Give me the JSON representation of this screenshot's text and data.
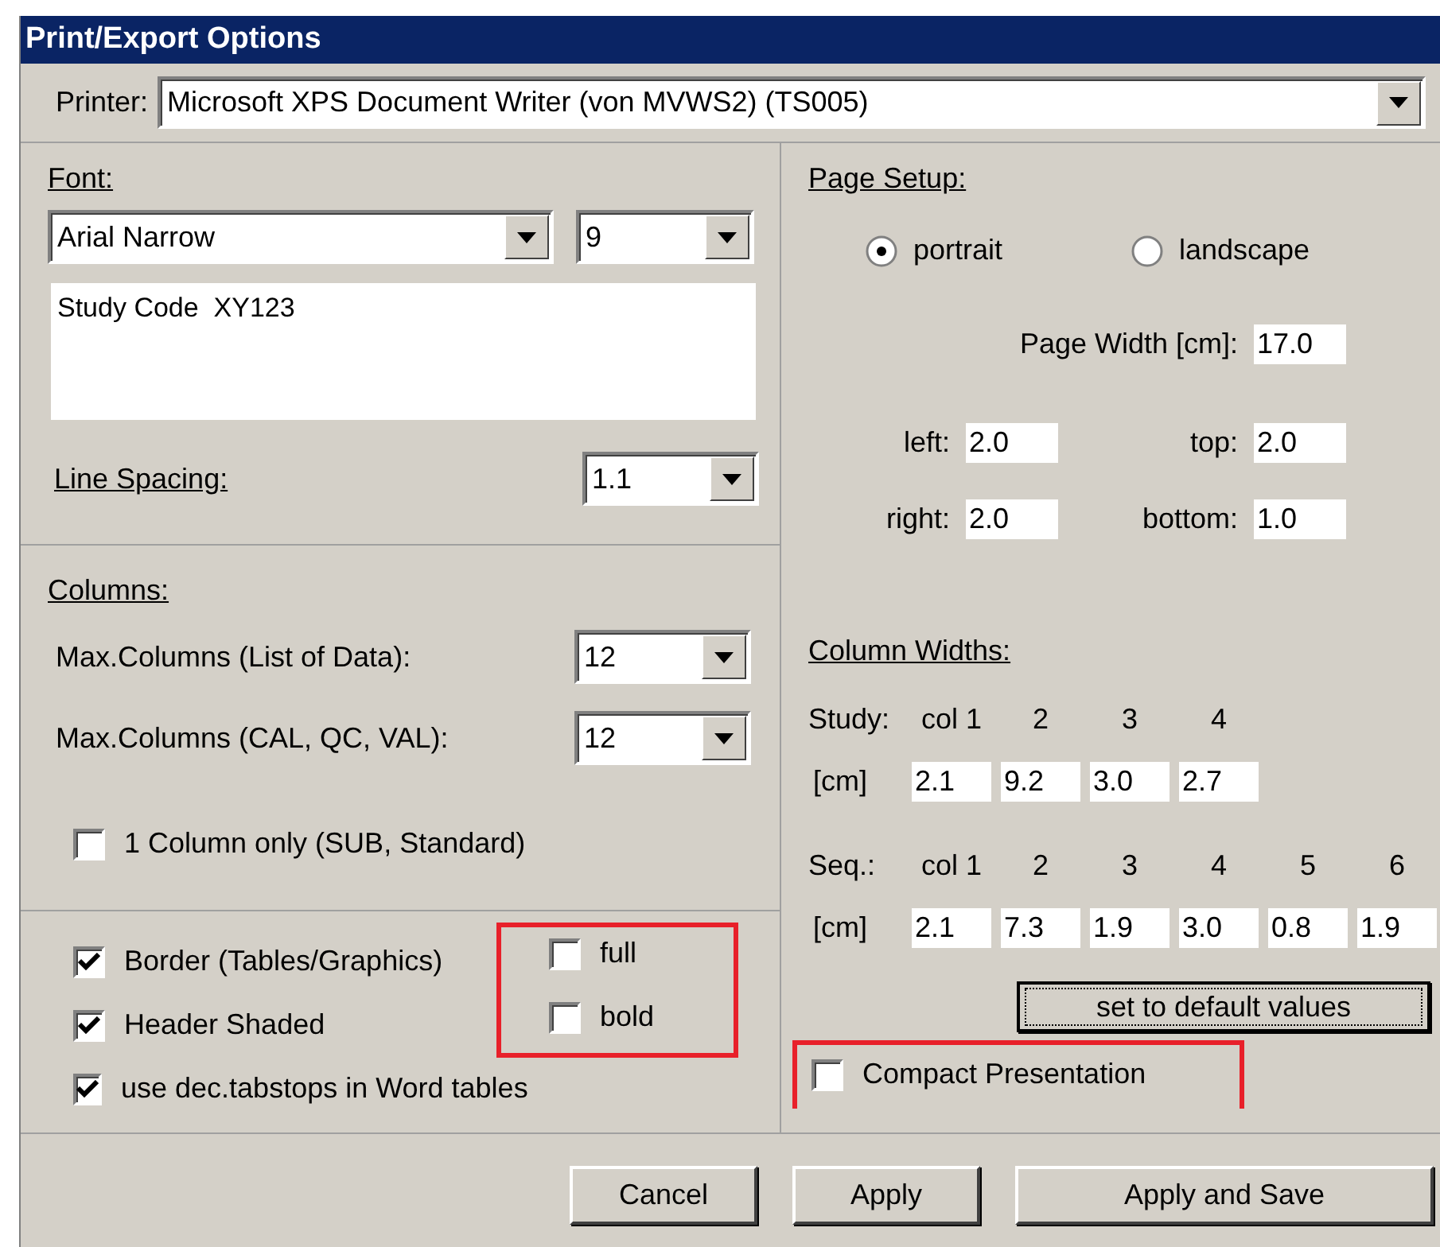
{
  "window": {
    "title": "Print/Export Options"
  },
  "printer": {
    "label": "Printer:",
    "value": "Microsoft XPS Document Writer (von MVWS2) (TS005)"
  },
  "font": {
    "heading": "Font:",
    "family": "Arial Narrow",
    "size": "9",
    "preview": "Study Code  XY123",
    "line_spacing_label": "Line Spacing:",
    "line_spacing": "1.1"
  },
  "columns": {
    "heading": "Columns:",
    "rows": [
      {
        "label": "Max.Columns (List of Data):",
        "value": "12"
      },
      {
        "label": "Max.Columns (CAL, QC, VAL):",
        "value": "12"
      }
    ],
    "single_column": {
      "label": "1 Column only (SUB, Standard)",
      "checked": false
    }
  },
  "table_options": [
    {
      "label": "Border (Tables/Graphics)",
      "checked": true
    },
    {
      "label": "Header Shaded",
      "checked": true
    },
    {
      "label": "use dec.tabstops in Word tables",
      "checked": true
    }
  ],
  "extra_options": {
    "highlighted": true,
    "items": [
      {
        "label": "full",
        "checked": false
      },
      {
        "label": "bold",
        "checked": false
      }
    ]
  },
  "page_setup": {
    "heading": "Page Setup:",
    "orientation": [
      {
        "label": "portrait",
        "selected": true
      },
      {
        "label": "landscape",
        "selected": false
      }
    ],
    "page_width": {
      "label": "Page Width [cm]:",
      "value": "17.0"
    },
    "margins": [
      {
        "label": "left:",
        "value": "2.0"
      },
      {
        "label": "top:",
        "value": "2.0"
      },
      {
        "label": "right:",
        "value": "2.0"
      },
      {
        "label": "bottom:",
        "value": "1.0"
      }
    ]
  },
  "column_widths": {
    "heading": "Column Widths:",
    "groups": [
      {
        "label": "Study:",
        "unit": "[cm]",
        "columns": [
          {
            "header": "col 1",
            "value": "2.1"
          },
          {
            "header": "2",
            "value": "9.2"
          },
          {
            "header": "3",
            "value": "3.0"
          },
          {
            "header": "4",
            "value": "2.7"
          }
        ]
      },
      {
        "label": "Seq.:",
        "unit": "[cm]",
        "columns": [
          {
            "header": "col 1",
            "value": "2.1"
          },
          {
            "header": "2",
            "value": "7.3"
          },
          {
            "header": "3",
            "value": "1.9"
          },
          {
            "header": "4",
            "value": "3.0"
          },
          {
            "header": "5",
            "value": "0.8"
          },
          {
            "header": "6",
            "value": "1.9"
          }
        ]
      }
    ]
  },
  "default_button": "set to default values",
  "compact": {
    "label": "Compact Presentation",
    "checked": false,
    "highlighted": true
  },
  "buttons": [
    "Cancel",
    "Apply",
    "Apply and Save"
  ]
}
